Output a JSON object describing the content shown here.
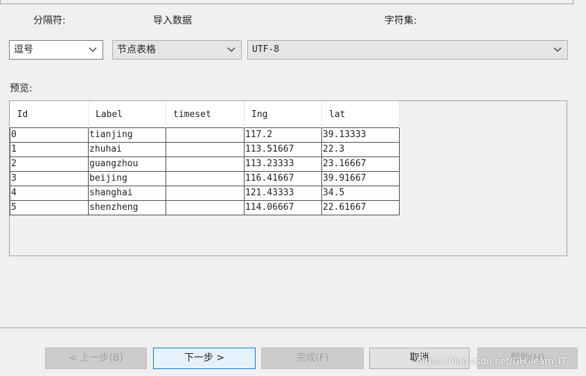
{
  "labels": {
    "separator": "分隔符:",
    "import_data": "导入数据",
    "charset": "字符集:",
    "preview": "预览:"
  },
  "separator_select": {
    "value": "逗号"
  },
  "import_select": {
    "value": "节点表格"
  },
  "charset_select": {
    "value": "UTF-8"
  },
  "table": {
    "columns": [
      "Id",
      "Label",
      "timeset",
      "Ing",
      "lat"
    ],
    "rows": [
      [
        "0",
        "tianjing",
        "",
        "117.2",
        "39.13333"
      ],
      [
        "1",
        "zhuhai",
        "",
        "113.51667",
        "22.3"
      ],
      [
        "2",
        "guangzhou",
        "",
        "113.23333",
        "23.16667"
      ],
      [
        "3",
        "beijing",
        "",
        "116.41667",
        "39.91667"
      ],
      [
        "4",
        "shanghai",
        "",
        "121.43333",
        "34.5"
      ],
      [
        "5",
        "shenzheng",
        "",
        "114.06667",
        "22.61667"
      ]
    ]
  },
  "buttons": {
    "back": "< 上一步(B)",
    "next": "下一步 >",
    "finish": "完成(F)",
    "cancel": "取消",
    "help": "帮助(H)"
  },
  "watermark": "https://blog.csdn.net/GH_learn_IT"
}
